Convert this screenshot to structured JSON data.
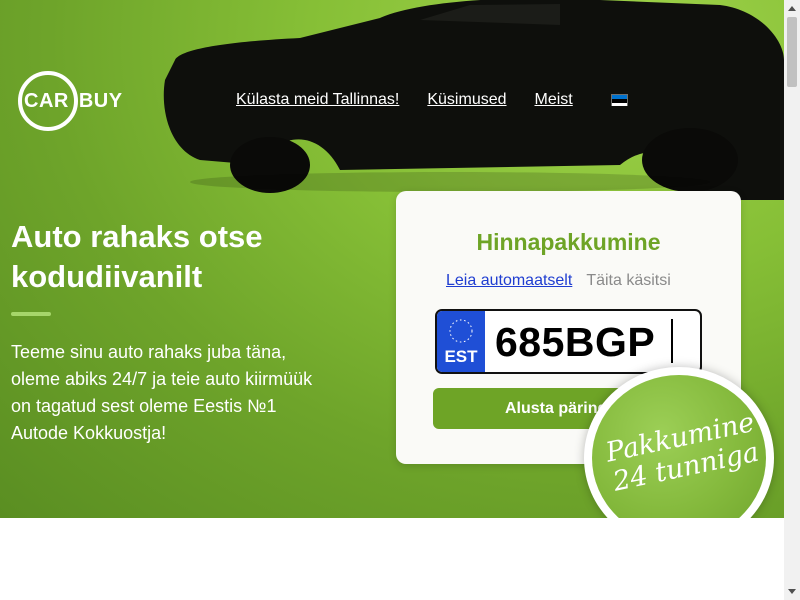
{
  "brand": {
    "logo_left": "CAR",
    "logo_right": "BUY"
  },
  "nav": {
    "items": [
      {
        "label": "Külasta meid Tallinnas!"
      },
      {
        "label": "Küsimused"
      },
      {
        "label": "Meist"
      }
    ],
    "language_flag": "estonian-flag-icon"
  },
  "hero": {
    "title": "Auto rahaks otse kodudiivanilt",
    "text": "Teeme sinu auto rahaks juba täna, oleme abiks 24/7 ja teie auto kiirmüük on tagatud sest oleme Eestis №1 Autode Kokkuostja!"
  },
  "quote": {
    "title": "Hinnapakkumine",
    "mode_auto": "Leia automaatselt",
    "mode_manual": "Täita käsitsi",
    "plate_country": "EST",
    "plate_value": "685BGP",
    "start_button": "Alusta päringut"
  },
  "badge": {
    "line1": "Pakkumine",
    "line2": "24 tunniga"
  },
  "colors": {
    "accent_green": "#6ea426",
    "link_blue": "#1f3dd1",
    "eu_blue": "#1f4fd6"
  }
}
